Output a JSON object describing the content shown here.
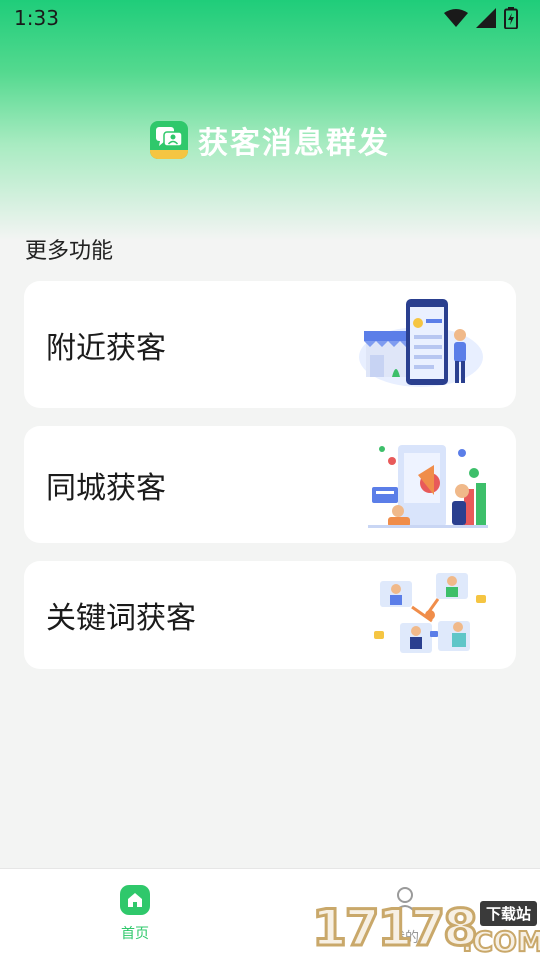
{
  "status_bar": {
    "time": "1:33",
    "icons": [
      "wifi-icon",
      "signal-icon",
      "battery-charging-icon"
    ]
  },
  "brand": {
    "title": "获客消息群发",
    "logo_icon": "chat-bubbles-logo-icon"
  },
  "section": {
    "title": "更多功能"
  },
  "cards": [
    {
      "label": "附近获客",
      "illustration": "storefront-phone-illustration"
    },
    {
      "label": "同城获客",
      "illustration": "city-marketing-illustration"
    },
    {
      "label": "关键词获客",
      "illustration": "keyword-network-illustration"
    }
  ],
  "bottom_nav": {
    "items": [
      {
        "label": "首页",
        "icon": "home-icon",
        "active": true
      },
      {
        "label": "我的",
        "icon": "user-icon",
        "active": false
      }
    ]
  },
  "watermark": {
    "digits": "17178",
    "suffix": ".COM",
    "tag": "下载站"
  },
  "colors": {
    "accent": "#2fc86b",
    "header_top": "#1fcd7a",
    "background": "#f3f4f3",
    "card": "#ffffff"
  }
}
